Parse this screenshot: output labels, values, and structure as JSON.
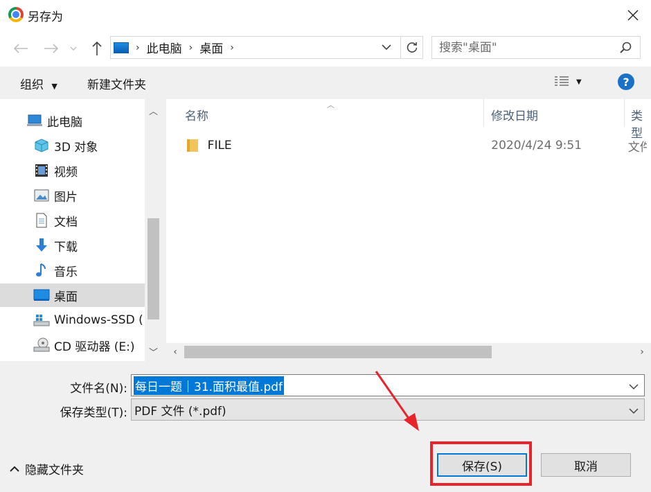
{
  "window": {
    "title": "另存为",
    "close_label": "✕"
  },
  "address": {
    "crumbs": [
      "此电脑",
      "桌面"
    ],
    "search_placeholder": "搜索\"桌面\""
  },
  "commands": {
    "organize": "组织",
    "new_folder": "新建文件夹",
    "help": "?"
  },
  "nav_pane": {
    "items": [
      {
        "label": "此电脑",
        "icon": "computer-icon"
      },
      {
        "label": "3D 对象",
        "icon": "cube-icon"
      },
      {
        "label": "视频",
        "icon": "film-icon"
      },
      {
        "label": "图片",
        "icon": "picture-icon"
      },
      {
        "label": "文档",
        "icon": "document-icon"
      },
      {
        "label": "下载",
        "icon": "download-icon"
      },
      {
        "label": "音乐",
        "icon": "music-icon"
      },
      {
        "label": "桌面",
        "icon": "desktop-icon",
        "selected": true
      },
      {
        "label": "Windows-SSD (",
        "icon": "drive-icon"
      },
      {
        "label": "CD 驱动器 (E:)",
        "icon": "cd-drive-icon"
      }
    ]
  },
  "file_list": {
    "columns": [
      "名称",
      "修改日期",
      "类型"
    ],
    "rows": [
      {
        "name": "FILE",
        "modified": "2020/4/24 9:51",
        "type": "文件"
      }
    ]
  },
  "form": {
    "filename_label": "文件名(N):",
    "filename_value": "每日一题｜31.面积最值.pdf",
    "filetype_label": "保存类型(T):",
    "filetype_value": "PDF 文件 (*.pdf)"
  },
  "footer": {
    "hide_folders": "隐藏文件夹",
    "save": "保存(S)",
    "cancel": "取消"
  },
  "colors": {
    "accent": "#0078d7",
    "highlight": "#e8232a",
    "selection": "#dcdcdc"
  }
}
